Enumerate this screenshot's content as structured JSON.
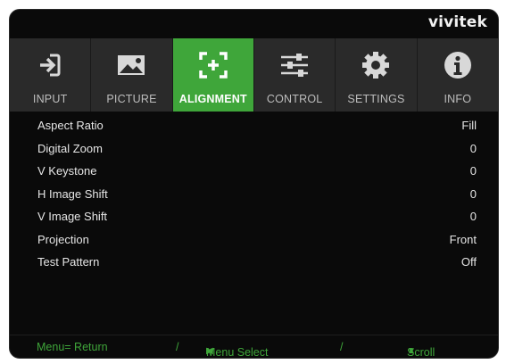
{
  "brand": {
    "name": "vivitek"
  },
  "tabs": [
    {
      "label": "INPUT",
      "icon": "input-icon"
    },
    {
      "label": "PICTURE",
      "icon": "picture-icon"
    },
    {
      "label": "ALIGNMENT",
      "icon": "alignment-icon",
      "active": true
    },
    {
      "label": "CONTROL",
      "icon": "sliders-icon"
    },
    {
      "label": "SETTINGS",
      "icon": "gear-icon"
    },
    {
      "label": "INFO",
      "icon": "info-icon"
    }
  ],
  "menu": {
    "items": [
      {
        "label": "Aspect Ratio",
        "value": "Fill"
      },
      {
        "label": "Digital Zoom",
        "value": "0"
      },
      {
        "label": "V Keystone",
        "value": "0"
      },
      {
        "label": "H Image Shift",
        "value": "0"
      },
      {
        "label": "V Image Shift",
        "value": "0"
      },
      {
        "label": "Projection",
        "value": "Front"
      },
      {
        "label": "Test Pattern",
        "value": "Off"
      }
    ]
  },
  "footer": {
    "menu_return": "Menu= Return",
    "sep1": "/",
    "menu_select": "Menu Select",
    "sep2": "/",
    "scroll": "Scroll",
    "left_arrow": "◀",
    "right_arrow": "▶",
    "up_arrow": "▲",
    "down_arrow": "▼"
  },
  "colors": {
    "accent": "#3fa63a",
    "background": "#0a0a0a",
    "tab_bg": "#2a2a2a",
    "text": "#e6e6e6"
  }
}
